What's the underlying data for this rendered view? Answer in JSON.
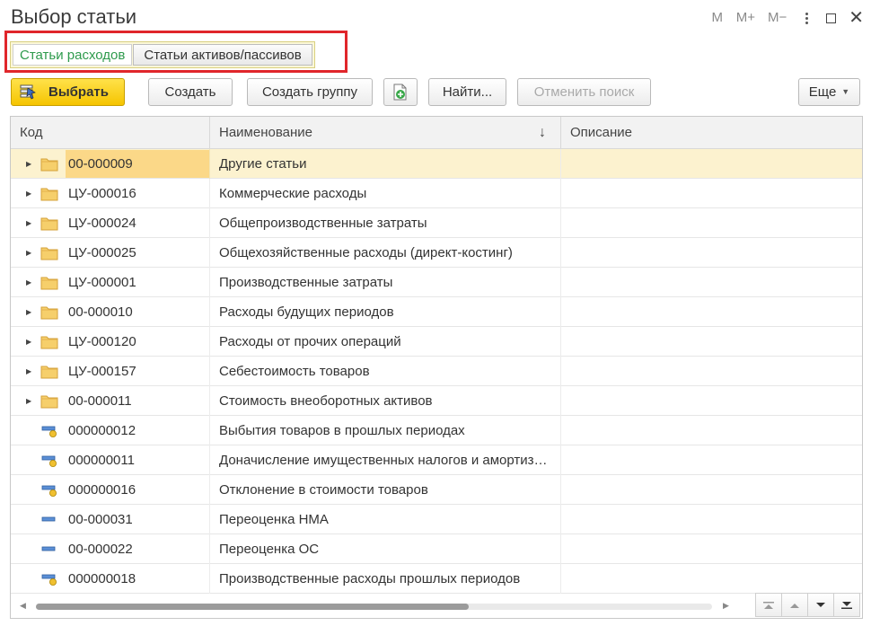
{
  "window": {
    "title": "Выбор статьи",
    "controls": [
      "M",
      "M+",
      "M−"
    ]
  },
  "tabs": [
    {
      "label": "Статьи расходов",
      "active": true
    },
    {
      "label": "Статьи активов/пассивов",
      "active": false
    }
  ],
  "toolbar": {
    "select_label": "Выбрать",
    "create_label": "Создать",
    "create_group_label": "Создать группу",
    "find_label": "Найти...",
    "cancel_search_label": "Отменить поиск",
    "more_label": "Еще"
  },
  "table": {
    "columns": [
      "Код",
      "Наименование",
      "Описание"
    ],
    "sort_indicator": "↓",
    "rows": [
      {
        "code": "00-000009",
        "name": "Другие статьи",
        "type": "folder"
      },
      {
        "code": "ЦУ-000016",
        "name": "Коммерческие расходы",
        "type": "folder"
      },
      {
        "code": "ЦУ-000024",
        "name": "Общепроизводственные затраты",
        "type": "folder"
      },
      {
        "code": "ЦУ-000025",
        "name": "Общехозяйственные расходы (директ-костинг)",
        "type": "folder"
      },
      {
        "code": "ЦУ-000001",
        "name": "Производственные затраты",
        "type": "folder"
      },
      {
        "code": "00-000010",
        "name": "Расходы будущих периодов",
        "type": "folder"
      },
      {
        "code": "ЦУ-000120",
        "name": "Расходы от прочих операций",
        "type": "folder"
      },
      {
        "code": "ЦУ-000157",
        "name": "Себестоимость товаров",
        "type": "folder"
      },
      {
        "code": "00-000011",
        "name": "Стоимость внеоборотных активов",
        "type": "folder"
      },
      {
        "code": "000000012",
        "name": "Выбытия товаров в прошлых периодах",
        "type": "item-marked"
      },
      {
        "code": "000000011",
        "name": "Доначисление имущественных налогов и амортизации",
        "type": "item-marked"
      },
      {
        "code": "000000016",
        "name": "Отклонение в стоимости товаров",
        "type": "item-marked"
      },
      {
        "code": "00-000031",
        "name": "Переоценка НМА",
        "type": "item"
      },
      {
        "code": "00-000022",
        "name": "Переоценка ОС",
        "type": "item"
      },
      {
        "code": "000000018",
        "name": "Производственные расходы прошлых периодов",
        "type": "item-marked"
      }
    ]
  },
  "colors": {
    "accent_green": "#2e9a4c",
    "primary_yellow": "#f5c400",
    "highlight_red": "#e0262b",
    "selected_row": "#fcf2cf"
  }
}
